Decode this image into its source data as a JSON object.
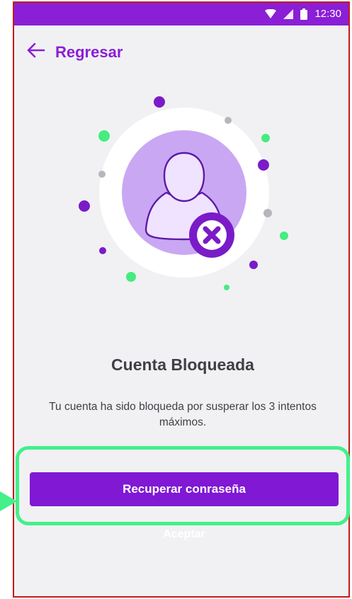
{
  "status_bar": {
    "time": "12:30",
    "icons": [
      "wifi-icon",
      "signal-icon",
      "battery-icon"
    ],
    "color": "#8a1fd6"
  },
  "header": {
    "back_label": "Regresar",
    "back_icon": "arrow-left-icon"
  },
  "illustration": {
    "icon": "locked-user-icon",
    "badge_icon": "close-x-icon"
  },
  "content": {
    "title": "Cuenta Bloqueada",
    "message": "Tu cuenta ha sido bloqueda por susperar los 3 intentos máximos."
  },
  "actions": {
    "primary_label": "Recuperar conraseña",
    "secondary_label": "Aceptar"
  },
  "colors": {
    "accent": "#8a1fd6",
    "button": "#8018d4",
    "highlight": "#43f08a",
    "frame": "#c61a1a"
  }
}
